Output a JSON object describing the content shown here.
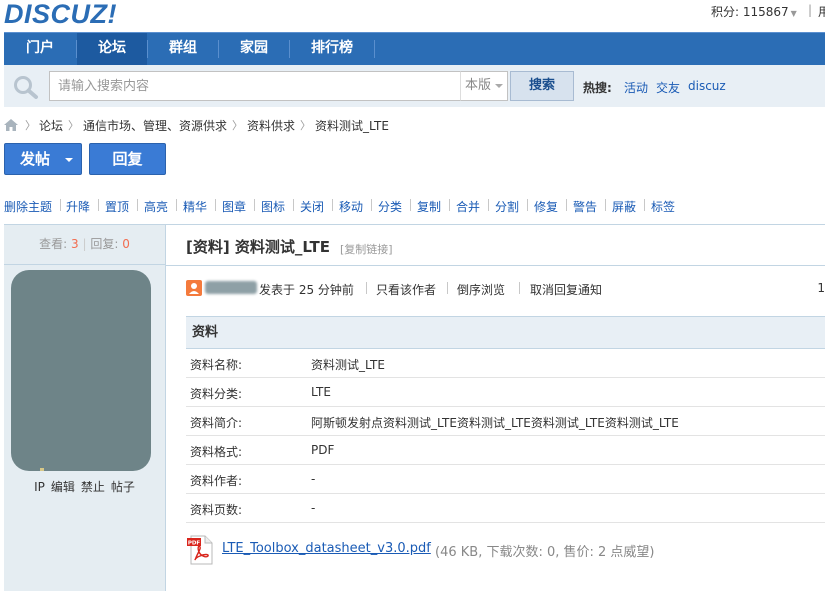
{
  "header": {
    "logo": "DISCUZ!",
    "credit": "积分: 115867",
    "more": "用"
  },
  "nav": {
    "items": [
      {
        "label": "门户"
      },
      {
        "label": "论坛"
      },
      {
        "label": "群组"
      },
      {
        "label": "家园"
      },
      {
        "label": "排行榜"
      }
    ],
    "active": "论坛"
  },
  "search": {
    "placeholder": "请输入搜索内容",
    "scope": "本版",
    "button": "搜索",
    "hot_label": "热搜:",
    "hot_links": [
      "活动",
      "交友",
      "discuz"
    ]
  },
  "breadcrumb": [
    "论坛",
    "通信市场、管理、资源供求",
    "资料供求",
    "资料测试_LTE"
  ],
  "actions": {
    "post": "发帖",
    "reply": "回复"
  },
  "moderation": [
    "删除主题",
    "升降",
    "置顶",
    "高亮",
    "精华",
    "图章",
    "图标",
    "关闭",
    "移动",
    "分类",
    "复制",
    "合并",
    "分割",
    "修复",
    "警告",
    "屏蔽",
    "标签"
  ],
  "stats": {
    "views_label": "查看:",
    "views": "3",
    "replies_label": "回复:",
    "replies": "0"
  },
  "user_actions": [
    "IP",
    "编辑",
    "禁止",
    "帖子"
  ],
  "thread": {
    "title": "[资料] 资料测试_LTE",
    "copy_link": "[复制链接]"
  },
  "author_bar": {
    "posted": "发表于  25 分钟前",
    "only_author": "只看该作者",
    "reverse": "倒序浏览",
    "cancel_notify": "取消回复通知",
    "floor": "1"
  },
  "info_table": {
    "heading": "资料",
    "rows": [
      {
        "label": "资料名称:",
        "value": "资料测试_LTE"
      },
      {
        "label": "资料分类:",
        "value": "LTE"
      },
      {
        "label": "资料简介:",
        "value": "阿斯顿发射点资料测试_LTE资料测试_LTE资料测试_LTE资料测试_LTE"
      },
      {
        "label": "资料格式:",
        "value": "PDF"
      },
      {
        "label": "资料作者:",
        "value": "-"
      },
      {
        "label": "资料页数:",
        "value": "-"
      }
    ]
  },
  "attachment": {
    "filename": "LTE_Toolbox_datasheet_v3.0.pdf",
    "meta": "(46 KB, 下载次数: 0, 售价: 2 点威望)",
    "icon_text": "PDF"
  },
  "colors": {
    "brand_blue": "#2b6db5",
    "nav_active": "#1d5aa0",
    "link": "#1a5bb5",
    "count_red": "#f26c4f"
  }
}
